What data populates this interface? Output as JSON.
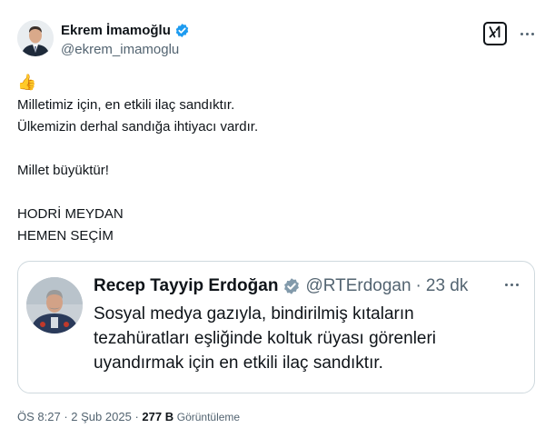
{
  "author": {
    "name": "Ekrem İmamoğlu",
    "handle": "@ekrem_imamoglu"
  },
  "post": {
    "emoji": "👍",
    "lines": [
      "Milletimiz için, en etkili ilaç sandıktır.",
      "Ülkemizin derhal sandığa ihtiyacı vardır.",
      "",
      "Millet büyüktür!",
      "",
      "HODRİ MEYDAN",
      "HEMEN SEÇİM"
    ]
  },
  "quote": {
    "name": "Recep Tayyip Erdoğan",
    "handle": "@RTErdogan",
    "separator": "·",
    "time": "23 dk",
    "lines": [
      "Sosyal medya gazıyla, bindirilmiş kıtaların",
      "tezahüratları eşliğinde koltuk rüyası görenleri",
      "uyandırmak için en etkili ilaç sandıktır."
    ]
  },
  "meta": {
    "time": "ÖS 8:27",
    "sep1": "·",
    "date": "2 Şub 2025",
    "sep2": "·",
    "views_count": "277 B",
    "views_label": "Görüntüleme"
  },
  "colors": {
    "verified": "#1d9bf0",
    "text": "#0f1419",
    "secondary": "#536471",
    "border": "#cfd9de"
  },
  "icons": {
    "verified": "verified-badge-icon",
    "grok": "grok-icon",
    "more": "more-icon"
  }
}
